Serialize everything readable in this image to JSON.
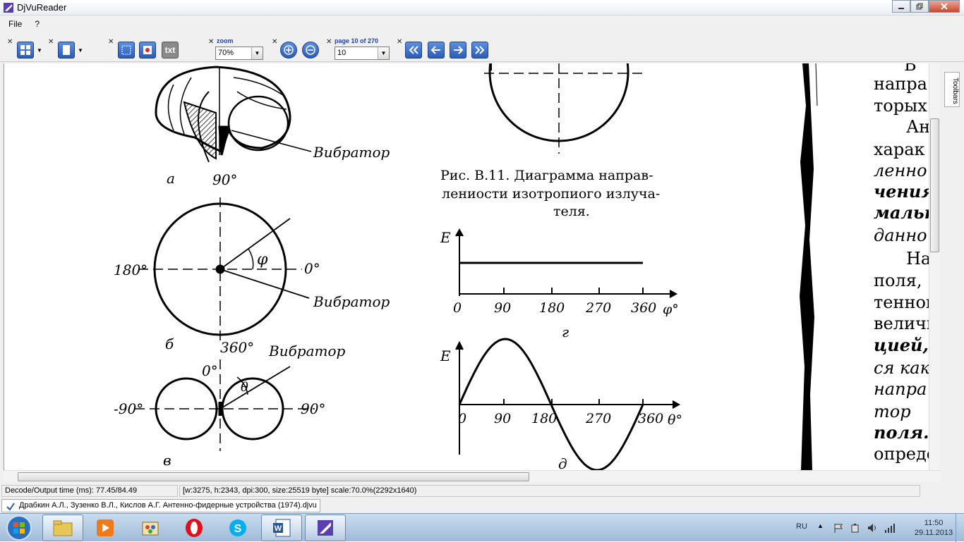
{
  "window": {
    "title": "DjVuReader"
  },
  "menu": {
    "items": [
      "File",
      "?"
    ]
  },
  "toolbar": {
    "zoom_label": "zoom",
    "zoom_value": "70%",
    "page_label": "page 10 of 270",
    "page_value": "10",
    "text_button": "txt"
  },
  "document": {
    "fig_a": {
      "label": "а",
      "vibrator": "Вибратор"
    },
    "fig_b": {
      "label": "б",
      "deg90": "90°",
      "deg180": "180°",
      "deg0": "0°",
      "deg360": "360°",
      "phi": "φ",
      "vibrator": "Вибратор"
    },
    "fig_v": {
      "label": "в",
      "deg0": "0°",
      "degm90": "-90°",
      "deg90": "90°",
      "theta": "θ",
      "vibrator": "Вибратор"
    },
    "caption": [
      "Рис. В.11. Диаграмма направ-",
      "лениости изотропиого излуча-",
      "теля."
    ],
    "fig_g": {
      "label": "г",
      "y_label": "Е",
      "ticks": [
        "0",
        "90",
        "180",
        "270",
        "360"
      ],
      "x_var": "φ°"
    },
    "fig_d": {
      "label": "д",
      "y_label": "Е",
      "ticks": [
        "0",
        "90",
        "180",
        "270",
        "360"
      ],
      "x_var": "θ°"
    },
    "right_text": [
      "В",
      "напра",
      "торых",
      "Ан",
      "харак",
      "ленно",
      "чения",
      "мальн",
      "данно",
      "На",
      "поля,",
      "тенной",
      "величи",
      "цией,",
      "ся как",
      "напра",
      "тор",
      "поля.",
      "опреде"
    ]
  },
  "side_panel": {
    "tab": "Toolbars"
  },
  "status": {
    "decode": "Decode/Output time (ms): 77.45/84.49",
    "info": "[w:3275, h:2343, dpi:300, size:25519 byte] scale:70.0%(2292x1640)"
  },
  "file_tab": {
    "name": "Драбкин А.Л., Зузенко В.Л., Кислов А.Г. Антенно-фидерные устройства (1974).djvu"
  },
  "tray": {
    "lang": "RU",
    "time": "11:50",
    "date": "29.11.2013"
  },
  "taskbar": {
    "apps": [
      "start",
      "explorer",
      "media-player",
      "paint",
      "opera",
      "skype",
      "word",
      "djvureader"
    ]
  }
}
